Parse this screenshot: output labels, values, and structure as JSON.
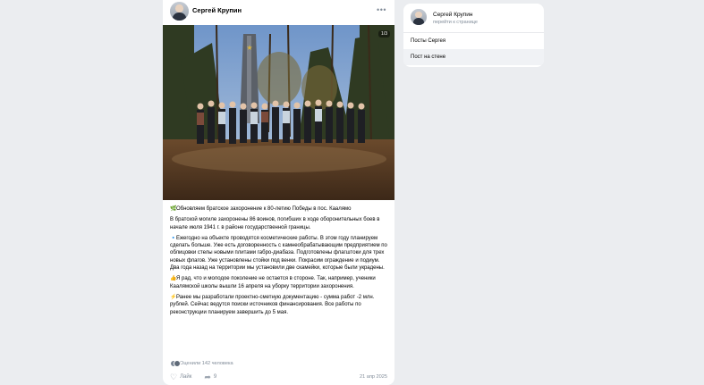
{
  "post": {
    "author": "Сергей Крупин",
    "more_label": "•••",
    "photo_counter": "1/3",
    "paragraphs": [
      {
        "emoji": "🌿",
        "text": "Обновляем братское захоронение к 80-летию Победы в пос. Каалямо"
      },
      {
        "emoji": "",
        "text": "В братской могиле захоронены 86 воинов, погибших в ходе оборонительных боев в начале июля 1941 г. в районе государственной границы."
      },
      {
        "emoji": "🔹",
        "text": "Ежегодно на объекте проводятся косметические работы. В этом году планируем сделать больше. Уже есть договоренность с камнеобрабатывающим предприятием по облицовки стелы новыми плитами габро-диабаза. Подготовлены флагштоки для трех новых флагов. Уже установлены стойки под венки. Покрасим ограждение и подиум. Два года назад на территории мы установили две скамейки, которые были украдены."
      },
      {
        "emoji": "👍",
        "text": "Я рад, что и молодое поколение не остается в стороне. Так, например, ученики Каалямской школы вышли 16 апреля на уборку территории захоронения."
      },
      {
        "emoji": "⚡",
        "text": "Ранее мы разработали проектно-сметную документацию - сумма работ -2 млн. рублей. Сейчас ведутся поиски источников финансирования. Все работы по реконструкции планируем завершить до 5 мая."
      }
    ],
    "views_text": "Оценили 142 человека",
    "like_label": "Лайк",
    "share_count": "9",
    "date": "21 апр 2025"
  },
  "sidebar": {
    "name": "Сергей Крупин",
    "link": "перейти к странице",
    "items": [
      {
        "label": "Посты Сергея"
      },
      {
        "label": "Пост на стене"
      }
    ]
  }
}
